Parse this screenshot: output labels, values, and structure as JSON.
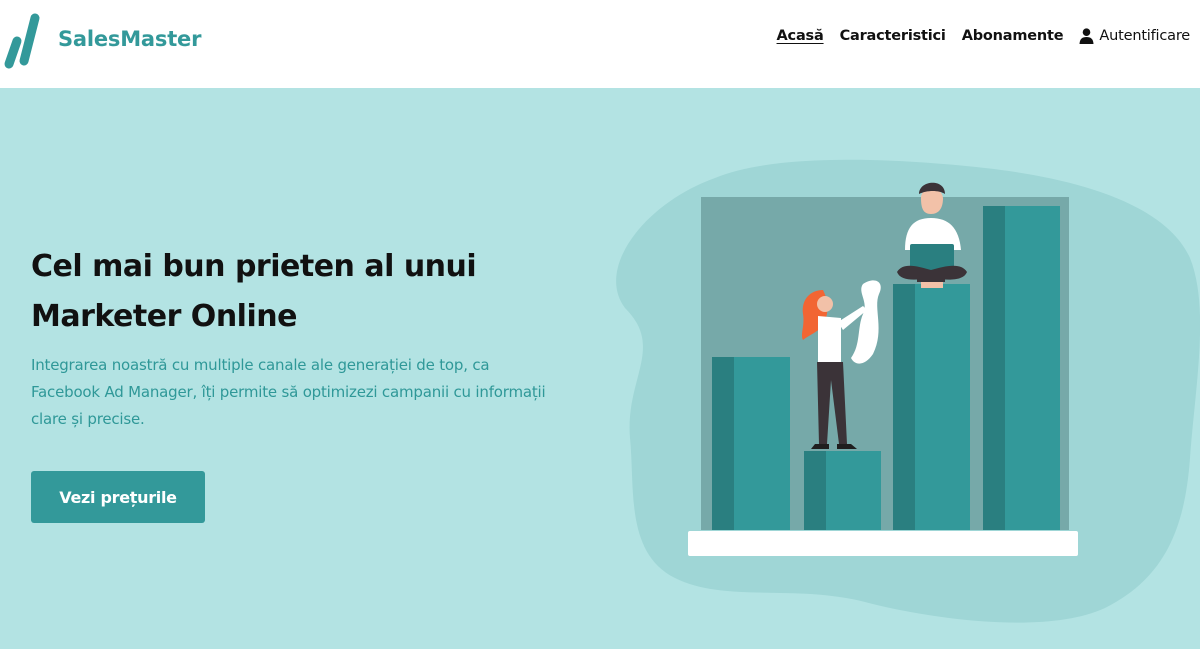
{
  "brand": {
    "name": "SalesMaster",
    "color": "#33999a"
  },
  "nav": {
    "items": [
      {
        "label": "Acasă",
        "active": true
      },
      {
        "label": "Caracteristici",
        "active": false
      },
      {
        "label": "Abonamente",
        "active": false
      }
    ],
    "login": {
      "label": "Autentificare",
      "icon": "user-icon"
    }
  },
  "hero": {
    "title_line1": "Cel mai bun prieten al unui",
    "title_line2": "Marketer Online",
    "description_line1": "Integrarea noastră cu multiple canale ale generației de top, ca",
    "description_line2": "Facebook Ad Manager, îți permite să optimizezi campanii cu informații",
    "description_line3": "clare și precise.",
    "cta_label": "Vezi prețurile",
    "illustration": "bar-chart-people-illustration"
  },
  "colors": {
    "background": "#b3e3e3",
    "accent": "#33999a",
    "navbar": "#ffffff"
  }
}
